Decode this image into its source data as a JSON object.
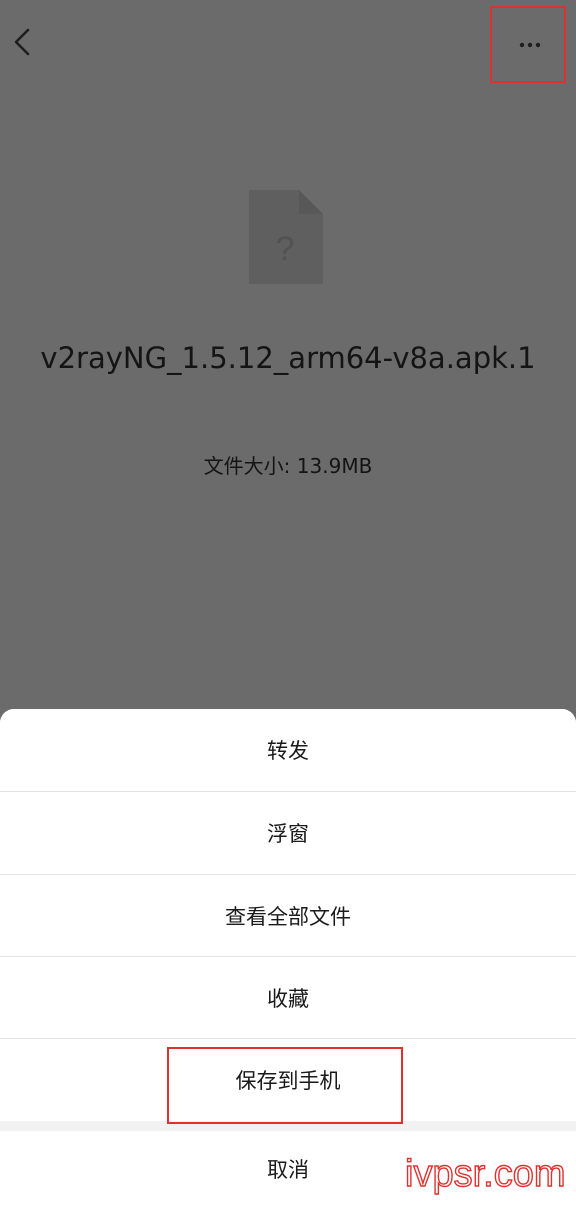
{
  "header": {
    "back_icon": "chevron-left-icon",
    "more_icon": "more-horizontal-icon"
  },
  "file": {
    "icon": "unknown-file-icon",
    "name": "v2rayNG_1.5.12_arm64-v8a.apk.1",
    "size_text": "文件大小: 13.9MB"
  },
  "action_sheet": {
    "items": [
      {
        "label": "转发"
      },
      {
        "label": "浮窗"
      },
      {
        "label": "查看全部文件"
      },
      {
        "label": "收藏"
      },
      {
        "label": "保存到手机"
      }
    ],
    "cancel_label": "取消"
  },
  "colors": {
    "overlay": "#6b6b6b",
    "highlight": "#e0312e",
    "watermark": "#e0312e"
  },
  "watermark": {
    "text": "ivpsr.com"
  }
}
